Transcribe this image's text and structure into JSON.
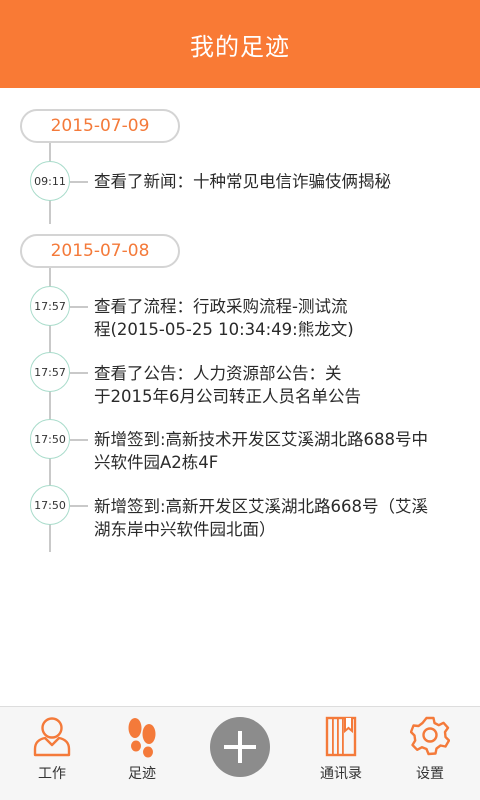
{
  "header": {
    "title": "我的足迹"
  },
  "timeline": {
    "days": [
      {
        "date": "2015-07-09",
        "entries": [
          {
            "time": "09:11",
            "text": "查看了新闻：十种常见电信诈骗伎俩揭秘"
          }
        ]
      },
      {
        "date": "2015-07-08",
        "entries": [
          {
            "time": "17:57",
            "line1": "查看了流程：行政采购流程-测试流",
            "line2": "程(2015-05-25 10:34:49:熊龙文)"
          },
          {
            "time": "17:57",
            "line1": "查看了公告：人力资源部公告：关",
            "line2": "于2015年6月公司转正人员名单公告"
          },
          {
            "time": "17:50",
            "line1": "新增签到:高新技术开发区艾溪湖北路688号中",
            "line2": "兴软件园A2栋4F"
          },
          {
            "time": "17:50",
            "line1": "新增签到:高新开发区艾溪湖北路668号（艾溪",
            "line2": "湖东岸中兴软件园北面）"
          }
        ]
      }
    ]
  },
  "tabbar": {
    "items": [
      {
        "label": "工作",
        "icon": "user-icon"
      },
      {
        "label": "足迹",
        "icon": "footprint-icon",
        "active": true
      },
      {
        "label": "",
        "icon": "plus-icon"
      },
      {
        "label": "通讯录",
        "icon": "contacts-book-icon"
      },
      {
        "label": "设置",
        "icon": "gear-icon"
      }
    ]
  },
  "colors": {
    "accent": "#f97a35",
    "circle_border": "#a9dccb",
    "add_button": "#8c8c8c"
  }
}
